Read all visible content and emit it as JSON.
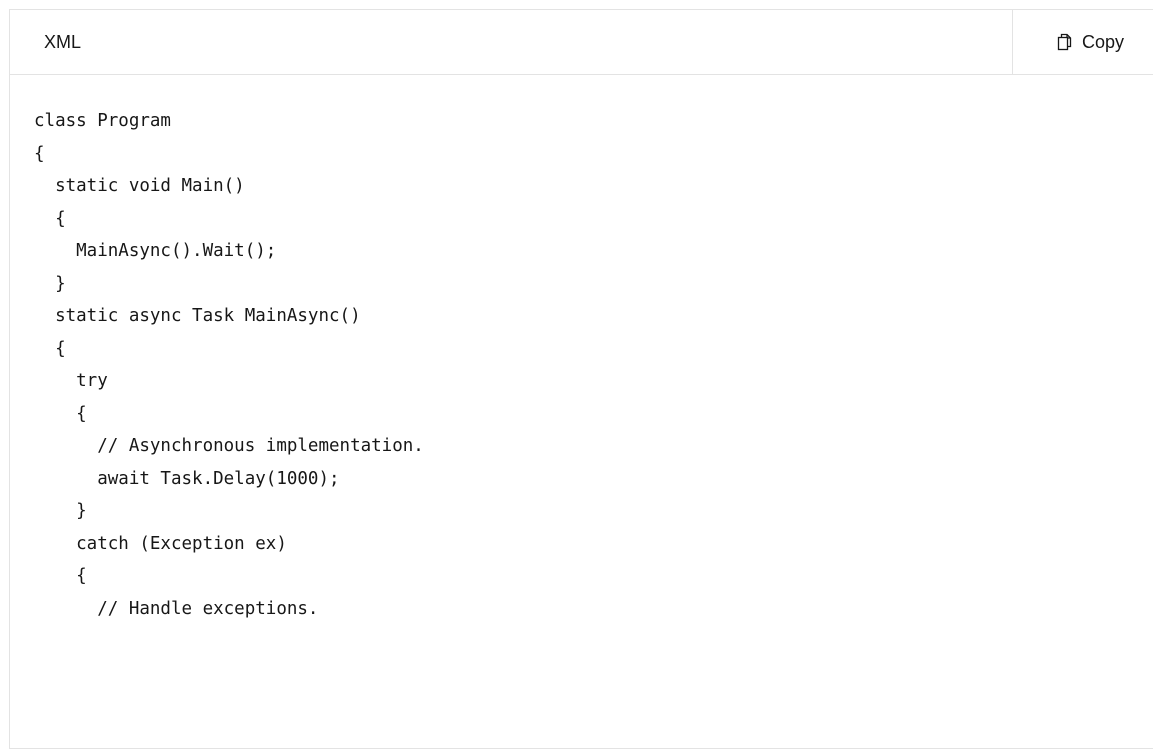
{
  "header": {
    "language": "XML",
    "copy_label": "Copy",
    "copy_icon": "copy-icon"
  },
  "code": {
    "lines": [
      "class Program",
      "{",
      "  static void Main()",
      "  {",
      "    MainAsync().Wait();",
      "  }",
      "  static async Task MainAsync()",
      "  {",
      "    try",
      "    {",
      "      // Asynchronous implementation.",
      "      await Task.Delay(1000);",
      "    }",
      "    catch (Exception ex)",
      "    {",
      "      // Handle exceptions."
    ]
  },
  "colors": {
    "text": "#171717",
    "border": "#e3e3e3",
    "background": "#ffffff"
  }
}
